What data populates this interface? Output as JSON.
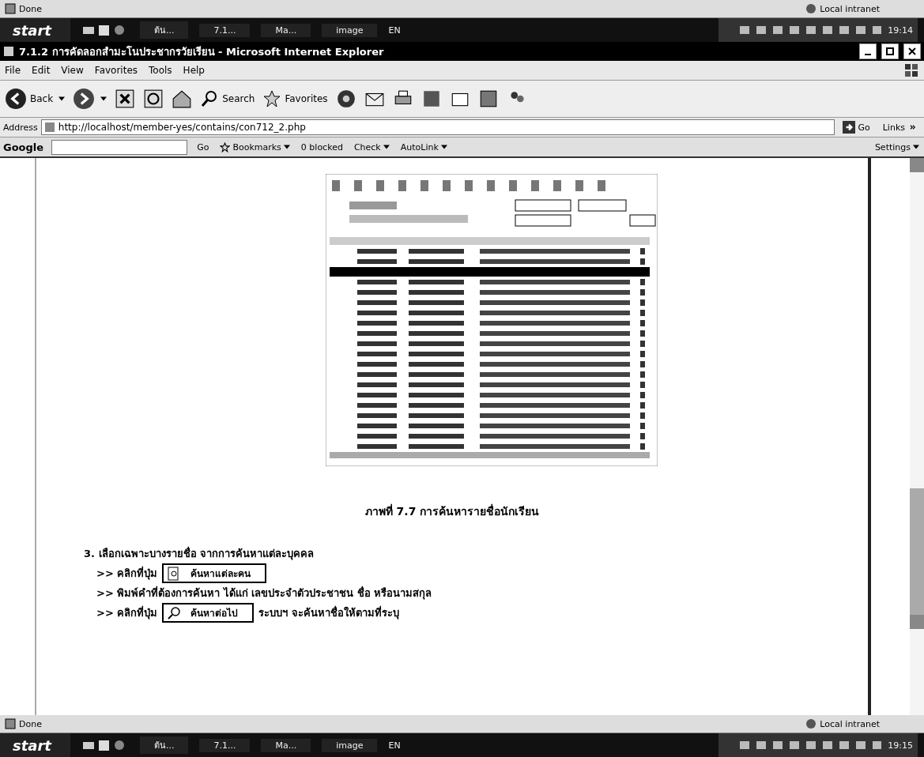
{
  "top_status_bar": {
    "status": "Done",
    "zone": "Local intranet"
  },
  "top_taskbar": {
    "start": "start",
    "tasks": [
      {
        "label": "ต้น..."
      },
      {
        "label": "7.1..."
      },
      {
        "label": "Ma..."
      },
      {
        "label": "image"
      }
    ],
    "language": "EN",
    "clock": "19:14"
  },
  "window": {
    "title": "7.1.2 การคัดลอกสำมะโนประชากรวัยเรียน - Microsoft Internet Explorer"
  },
  "menu": [
    "File",
    "Edit",
    "View",
    "Favorites",
    "Tools",
    "Help"
  ],
  "toolbar": {
    "back": "Back",
    "search": "Search",
    "favorites": "Favorites"
  },
  "address_bar": {
    "label": "Address",
    "url": "http://localhost/member-yes/contains/con712_2.php",
    "go": "Go",
    "links": "Links"
  },
  "google_toolbar": {
    "brand": "Google",
    "go": "Go",
    "bookmarks": "Bookmarks",
    "blocked": "0 blocked",
    "check": "Check",
    "autolink": "AutoLink",
    "settings": "Settings"
  },
  "content": {
    "caption": "ภาพที่ 7.7 การค้นหารายชื่อนักเรียน",
    "step": "3. เลือกเฉพาะบางรายชื่อ จากการค้นหาแต่ละบุคคล",
    "lines": [
      {
        "text": ">> คลิกที่ปุ่ม",
        "button": "ค้นหาแต่ละคน"
      },
      {
        "text": ">> พิมพ์คำที่ต้องการค้นหา ได้แก่  เลขประจำตัวประชาชน ชื่อ หรือนามสกุล"
      },
      {
        "text": ">> คลิกที่ปุ่ม",
        "button": "ค้นหาต่อไป",
        "after": "ระบบฯ จะค้นหาชื่อให้ตามที่ระบุ"
      }
    ]
  },
  "bottom_status_bar": {
    "status": "Done",
    "zone": "Local intranet"
  },
  "bottom_taskbar": {
    "start": "start",
    "tasks": [
      {
        "label": "ต้น..."
      },
      {
        "label": "7.1..."
      },
      {
        "label": "Ma..."
      },
      {
        "label": "image"
      }
    ],
    "language": "EN",
    "clock": "19:15"
  }
}
